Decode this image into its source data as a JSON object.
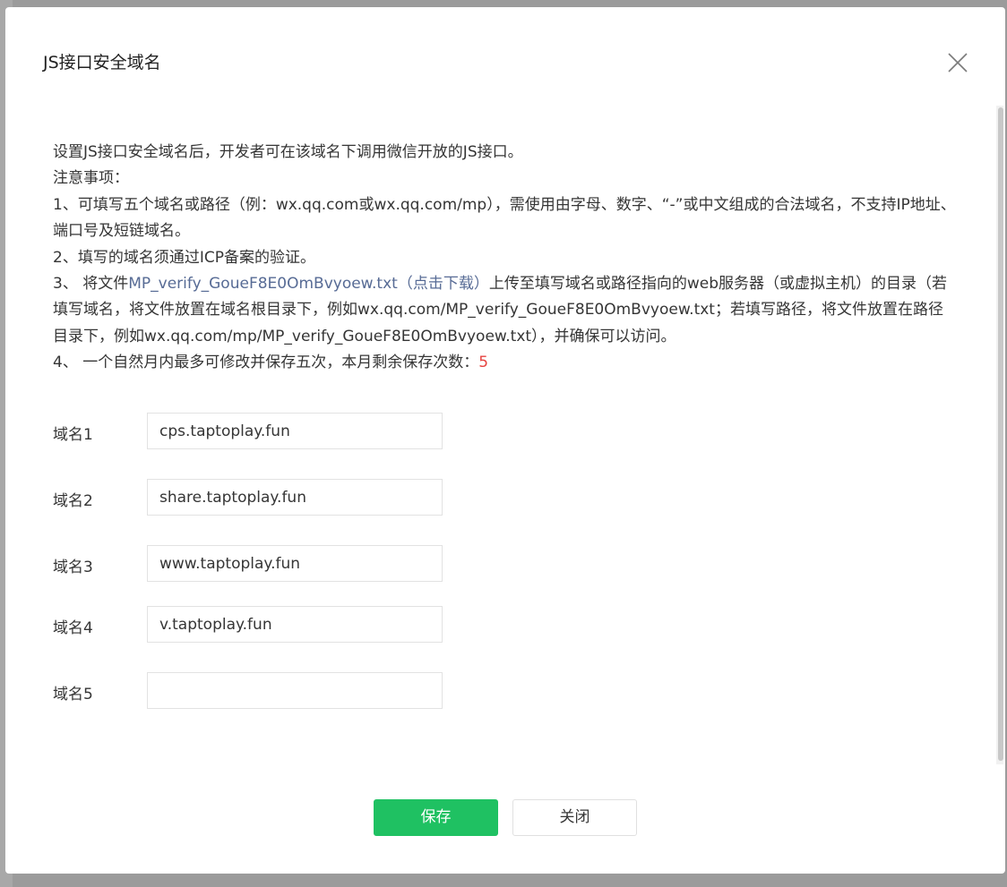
{
  "dialog": {
    "title": "JS接口安全域名"
  },
  "notes": {
    "intro": "设置JS接口安全域名后，开发者可在该域名下调用微信开放的JS接口。",
    "heading": "注意事项：",
    "item1": "1、可填写五个域名或路径（例：wx.qq.com或wx.qq.com/mp），需使用由字母、数字、“-”或中文组成的合法域名，不支持IP地址、端口号及短链域名。",
    "item2": "2、填写的域名须通过ICP备案的验证。",
    "item3_prefix": "3、 将文件",
    "item3_link": "MP_verify_GoueF8E0OmBvyoew.txt（点击下载）",
    "item3_suffix": "上传至填写域名或路径指向的web服务器（或虚拟主机）的目录（若填写域名，将文件放置在域名根目录下，例如wx.qq.com/MP_verify_GoueF8E0OmBvyoew.txt；若填写路径，将文件放置在路径目录下，例如wx.qq.com/mp/MP_verify_GoueF8E0OmBvyoew.txt），并确保可以访问。",
    "item4_prefix": "4、 一个自然月内最多可修改并保存五次，本月剩余保存次数：",
    "item4_count": "5"
  },
  "domains": [
    {
      "label": "域名1",
      "value": "cps.taptoplay.fun"
    },
    {
      "label": "域名2",
      "value": "share.taptoplay.fun"
    },
    {
      "label": "域名3",
      "value": "www.taptoplay.fun"
    },
    {
      "label": "域名4",
      "value": "v.taptoplay.fun"
    },
    {
      "label": "域名5",
      "value": ""
    }
  ],
  "buttons": {
    "save": "保存",
    "close": "关闭"
  },
  "colors": {
    "primary": "#1fc162",
    "link": "#576b95",
    "count": "#e64340"
  },
  "icons": {
    "close": "close-icon"
  }
}
